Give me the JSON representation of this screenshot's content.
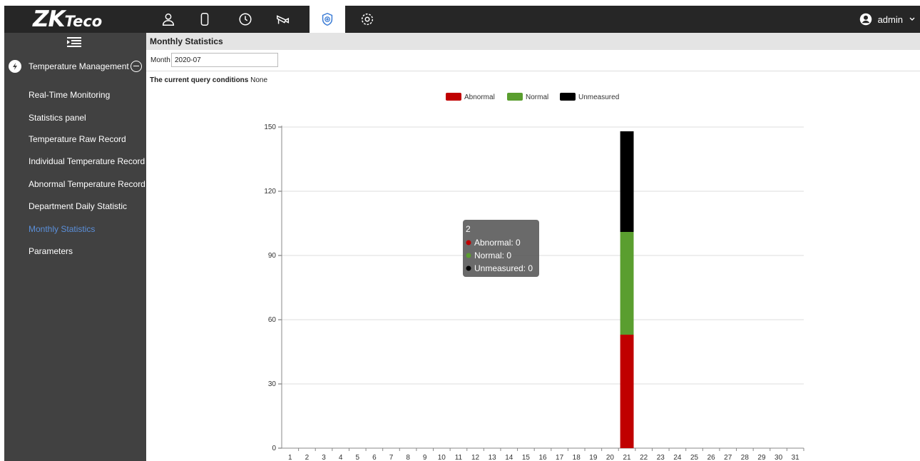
{
  "brand": {
    "logo_main": "ZK",
    "logo_sub": "Teco"
  },
  "nav": {
    "icons": [
      "person-icon",
      "door-icon",
      "clock-icon",
      "camera-icon",
      "shield-plus-icon",
      "gear-icon"
    ],
    "active_index": 4
  },
  "user": {
    "name": "admin"
  },
  "sidebar": {
    "section": "Temperature Management",
    "items": [
      {
        "label": "Real-Time Monitoring",
        "active": false
      },
      {
        "label": "Statistics panel",
        "active": false
      },
      {
        "label": "Temperature Raw Record",
        "active": false
      },
      {
        "label": "Individual Temperature Record",
        "active": false
      },
      {
        "label": "Abnormal Temperature Record",
        "active": false
      },
      {
        "label": "Department Daily Statistic",
        "active": false
      },
      {
        "label": "Monthly Statistics",
        "active": true
      },
      {
        "label": "Parameters",
        "active": false
      }
    ]
  },
  "page": {
    "title": "Monthly Statistics",
    "month_label": "Month",
    "month_value": "2020-07",
    "query_label": "The current query conditions",
    "query_value": "None"
  },
  "colors": {
    "abnormal": "#c00000",
    "normal": "#5a9e2f",
    "unmeasured": "#000000",
    "accent": "#5b8fd9"
  },
  "chart_data": {
    "type": "bar",
    "stacked": true,
    "categories": [
      "1",
      "2",
      "3",
      "4",
      "5",
      "6",
      "7",
      "8",
      "9",
      "10",
      "11",
      "12",
      "13",
      "14",
      "15",
      "16",
      "17",
      "18",
      "19",
      "20",
      "21",
      "22",
      "23",
      "24",
      "25",
      "26",
      "27",
      "28",
      "29",
      "30",
      "31"
    ],
    "series": [
      {
        "name": "Abnormal",
        "color": "#c00000",
        "values": [
          0,
          0,
          0,
          0,
          0,
          0,
          0,
          0,
          0,
          0,
          0,
          0,
          0,
          0,
          0,
          0,
          0,
          0,
          0,
          0,
          53,
          0,
          0,
          0,
          0,
          0,
          0,
          0,
          0,
          0,
          0
        ]
      },
      {
        "name": "Normal",
        "color": "#5a9e2f",
        "values": [
          0,
          0,
          0,
          0,
          0,
          0,
          0,
          0,
          0,
          0,
          0,
          0,
          0,
          0,
          0,
          0,
          0,
          0,
          0,
          0,
          48,
          0,
          0,
          0,
          0,
          0,
          0,
          0,
          0,
          0,
          0
        ]
      },
      {
        "name": "Unmeasured",
        "color": "#000000",
        "values": [
          0,
          0,
          0,
          0,
          0,
          0,
          0,
          0,
          0,
          0,
          0,
          0,
          0,
          0,
          0,
          0,
          0,
          0,
          0,
          0,
          47,
          0,
          0,
          0,
          0,
          0,
          0,
          0,
          0,
          0,
          0
        ]
      }
    ],
    "yticks": [
      "0",
      "30",
      "60",
      "90",
      "120",
      "150"
    ],
    "ylim": [
      0,
      150
    ],
    "grid": true,
    "legend": "top-center",
    "tooltip": {
      "title": "2",
      "rows": [
        "Abnormal: 0",
        "Normal: 0",
        "Unmeasured: 0"
      ]
    }
  }
}
